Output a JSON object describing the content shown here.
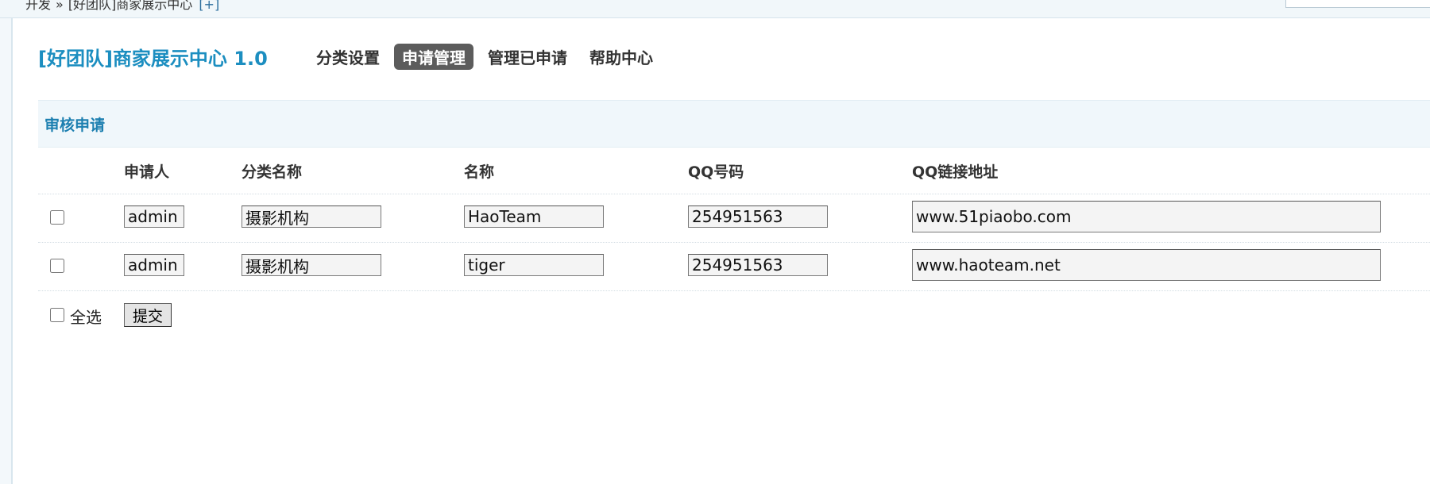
{
  "breadcrumb": {
    "root": "开发",
    "separator": "»",
    "current": "[好团队]商家展示中心",
    "add_link": "[+]"
  },
  "header": {
    "app_title": "[好团队]商家展示中心 1.0",
    "nav": [
      {
        "label": "分类设置",
        "active": false
      },
      {
        "label": "申请管理",
        "active": true
      },
      {
        "label": "管理已申请",
        "active": false
      },
      {
        "label": "帮助中心",
        "active": false
      }
    ]
  },
  "section": {
    "title": "审核申请"
  },
  "table": {
    "columns": [
      "申请人",
      "分类名称",
      "名称",
      "QQ号码",
      "QQ链接地址"
    ],
    "rows": [
      {
        "applicant": "admin",
        "category": "摄影机构",
        "name": "HaoTeam",
        "qq": "254951563",
        "qq_url": "www.51piaobo.com",
        "checked": false
      },
      {
        "applicant": "admin",
        "category": "摄影机构",
        "name": "tiger",
        "qq": "254951563",
        "qq_url": "www.haoteam.net",
        "checked": false
      }
    ]
  },
  "footer": {
    "select_all_label": "全选",
    "submit_label": "提交"
  },
  "colors": {
    "accent": "#1c8ec0",
    "active_tab_bg": "#5c5c5c",
    "section_bg": "#f0f7fb"
  }
}
